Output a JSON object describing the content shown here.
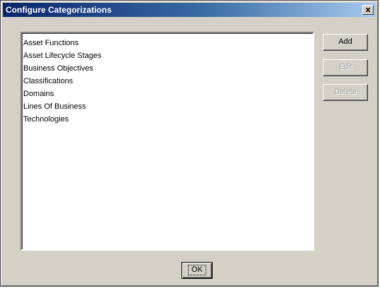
{
  "window": {
    "title": "Configure Categorizations",
    "close_glyph": "x"
  },
  "list": {
    "items": [
      "Asset Functions",
      "Asset Lifecycle Stages",
      "Business Objectives",
      "Classifications",
      "Domains",
      "Lines Of Business",
      "Technologies"
    ]
  },
  "buttons": {
    "add": "Add",
    "edit": "Edit",
    "delete": "Delete",
    "ok": "OK"
  },
  "colors": {
    "dialog_face": "#d4d0c8",
    "titlebar_start": "#0a246a",
    "titlebar_end": "#a6caf0",
    "disabled_text": "#a0a0a0"
  }
}
